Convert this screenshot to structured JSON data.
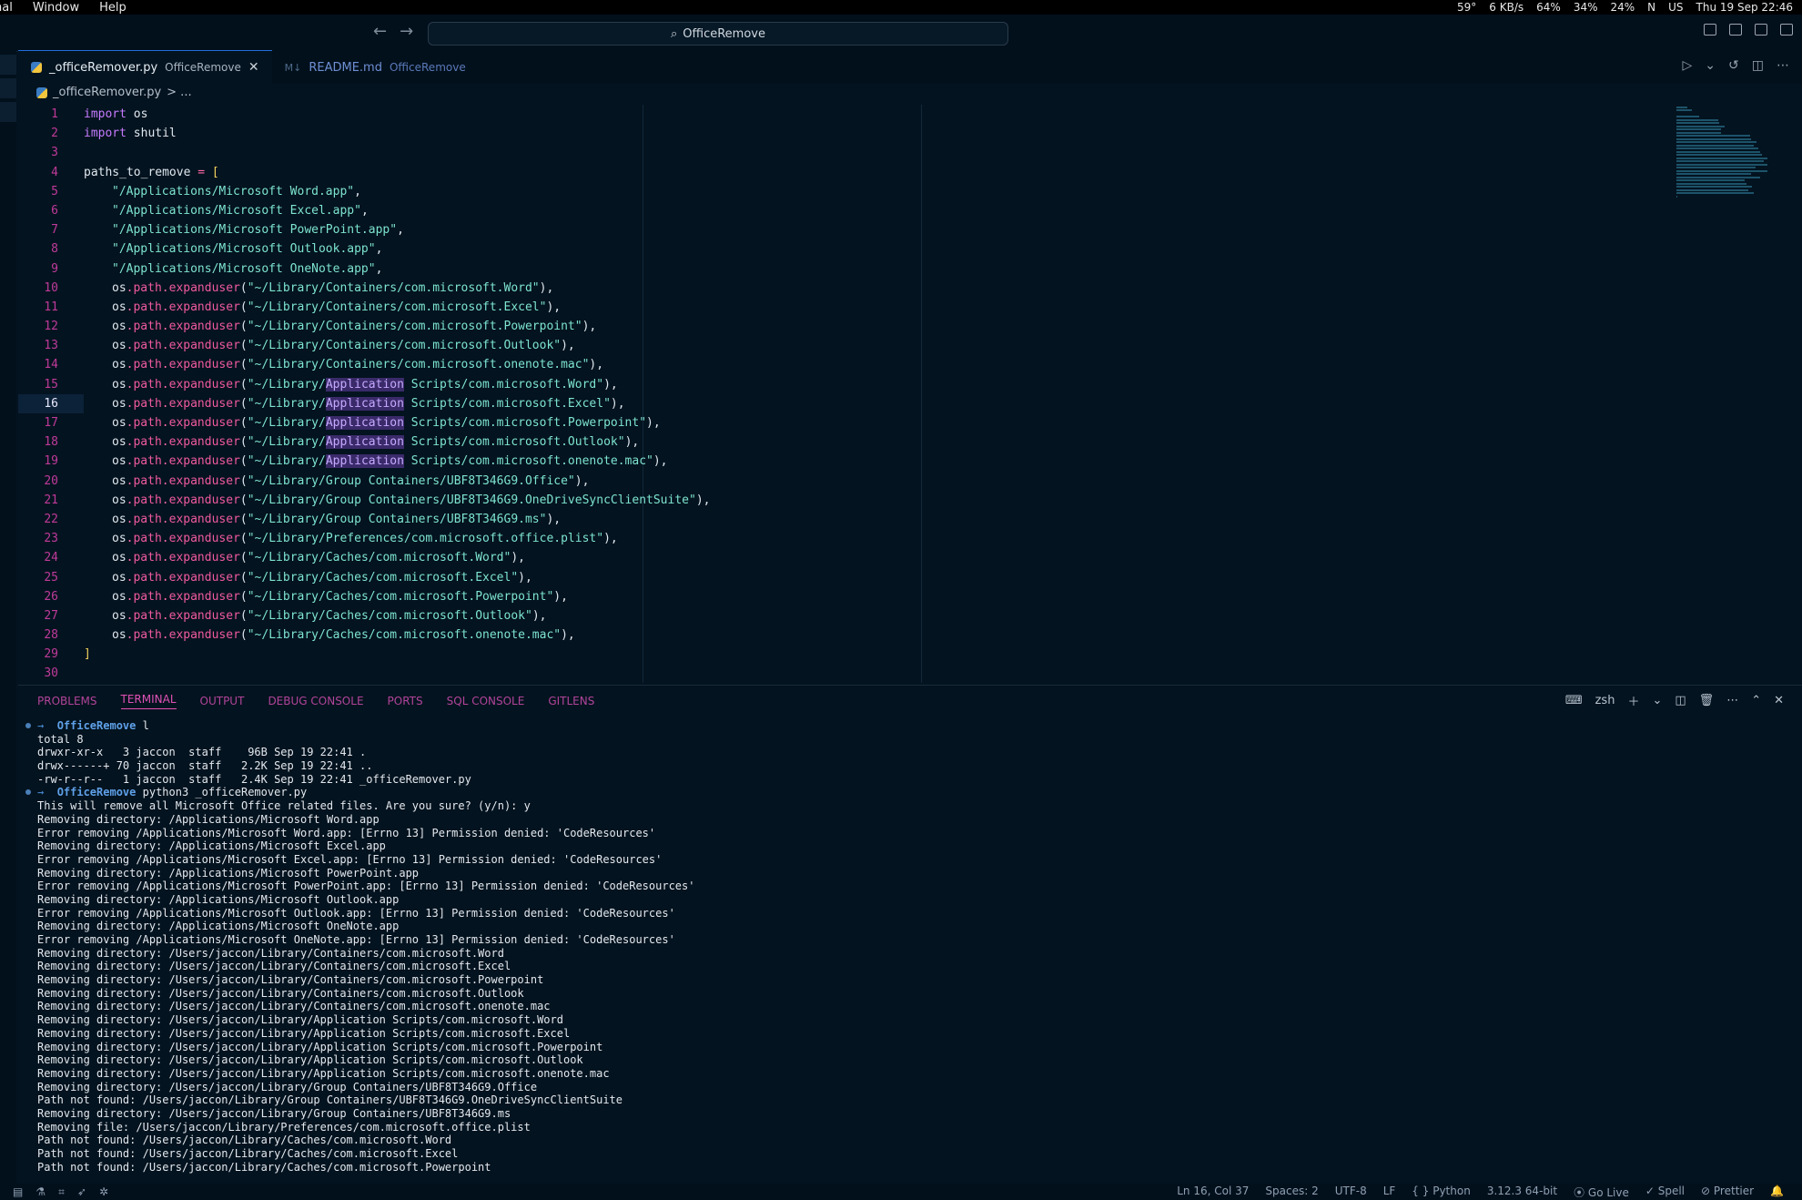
{
  "menubar": {
    "menus": [
      "nal",
      "Window",
      "Help"
    ],
    "status": [
      "59°",
      "6 KB/s",
      "64%",
      "34%",
      "24%",
      "N",
      "US",
      "Thu 19 Sep  22:46"
    ]
  },
  "titlebar": {
    "search_text": "OfficeRemove"
  },
  "tabs": [
    {
      "label": "_officeRemover.py",
      "sub": "OfficeRemove",
      "active": true
    },
    {
      "label": "README.md",
      "sub": "OfficeRemove",
      "active": false
    }
  ],
  "breadcrumb": {
    "file": "_officeRemover.py",
    "rest": "> ..."
  },
  "code": {
    "current_line": 16,
    "lines": [
      [
        [
          "kw",
          "import "
        ],
        [
          "id",
          "os"
        ]
      ],
      [
        [
          "kw",
          "import "
        ],
        [
          "id",
          "shutil"
        ]
      ],
      [],
      [
        [
          "id",
          "paths_to_remove "
        ],
        [
          "op",
          "= "
        ],
        [
          "brk",
          "["
        ]
      ],
      [
        [
          "ind",
          ""
        ],
        [
          "str",
          "\"/Applications/Microsoft Word.app\""
        ],
        [
          "id",
          ","
        ]
      ],
      [
        [
          "ind",
          ""
        ],
        [
          "str",
          "\"/Applications/Microsoft Excel.app\""
        ],
        [
          "id",
          ","
        ]
      ],
      [
        [
          "ind",
          ""
        ],
        [
          "str",
          "\"/Applications/Microsoft PowerPoint.app\""
        ],
        [
          "id",
          ","
        ]
      ],
      [
        [
          "ind",
          ""
        ],
        [
          "str",
          "\"/Applications/Microsoft Outlook.app\""
        ],
        [
          "id",
          ","
        ]
      ],
      [
        [
          "ind",
          ""
        ],
        [
          "str",
          "\"/Applications/Microsoft OneNote.app\""
        ],
        [
          "id",
          ","
        ]
      ],
      [
        [
          "ind",
          ""
        ],
        [
          "id",
          "os"
        ],
        [
          "op",
          "."
        ],
        [
          "fn",
          "path"
        ],
        [
          "op",
          "."
        ],
        [
          "fn",
          "expanduser"
        ],
        [
          "id",
          "("
        ],
        [
          "str",
          "\"~/Library/Containers/com.microsoft.Word\""
        ],
        [
          "id",
          "),"
        ]
      ],
      [
        [
          "ind",
          ""
        ],
        [
          "id",
          "os"
        ],
        [
          "op",
          "."
        ],
        [
          "fn",
          "path"
        ],
        [
          "op",
          "."
        ],
        [
          "fn",
          "expanduser"
        ],
        [
          "id",
          "("
        ],
        [
          "str",
          "\"~/Library/Containers/com.microsoft.Excel\""
        ],
        [
          "id",
          "),"
        ]
      ],
      [
        [
          "ind",
          ""
        ],
        [
          "id",
          "os"
        ],
        [
          "op",
          "."
        ],
        [
          "fn",
          "path"
        ],
        [
          "op",
          "."
        ],
        [
          "fn",
          "expanduser"
        ],
        [
          "id",
          "("
        ],
        [
          "str",
          "\"~/Library/Containers/com.microsoft.Powerpoint\""
        ],
        [
          "id",
          "),"
        ]
      ],
      [
        [
          "ind",
          ""
        ],
        [
          "id",
          "os"
        ],
        [
          "op",
          "."
        ],
        [
          "fn",
          "path"
        ],
        [
          "op",
          "."
        ],
        [
          "fn",
          "expanduser"
        ],
        [
          "id",
          "("
        ],
        [
          "str",
          "\"~/Library/Containers/com.microsoft.Outlook\""
        ],
        [
          "id",
          "),"
        ]
      ],
      [
        [
          "ind",
          ""
        ],
        [
          "id",
          "os"
        ],
        [
          "op",
          "."
        ],
        [
          "fn",
          "path"
        ],
        [
          "op",
          "."
        ],
        [
          "fn",
          "expanduser"
        ],
        [
          "id",
          "("
        ],
        [
          "str",
          "\"~/Library/Containers/com.microsoft.onenote.mac\""
        ],
        [
          "id",
          "),"
        ]
      ],
      [
        [
          "ind",
          ""
        ],
        [
          "id",
          "os"
        ],
        [
          "op",
          "."
        ],
        [
          "fn",
          "path"
        ],
        [
          "op",
          "."
        ],
        [
          "fn",
          "expanduser"
        ],
        [
          "id",
          "("
        ],
        [
          "str",
          "\"~/Library/"
        ],
        [
          "hl",
          "Application"
        ],
        [
          "str",
          " Scripts/com.microsoft.Word\""
        ],
        [
          "id",
          "),"
        ]
      ],
      [
        [
          "ind",
          ""
        ],
        [
          "id",
          "os"
        ],
        [
          "op",
          "."
        ],
        [
          "fn",
          "path"
        ],
        [
          "op",
          "."
        ],
        [
          "fn",
          "expanduser"
        ],
        [
          "id",
          "("
        ],
        [
          "str",
          "\"~/Library/"
        ],
        [
          "hl",
          "Application"
        ],
        [
          "str",
          " Scripts/com.microsoft.Excel\""
        ],
        [
          "id",
          "),"
        ]
      ],
      [
        [
          "ind",
          ""
        ],
        [
          "id",
          "os"
        ],
        [
          "op",
          "."
        ],
        [
          "fn",
          "path"
        ],
        [
          "op",
          "."
        ],
        [
          "fn",
          "expanduser"
        ],
        [
          "id",
          "("
        ],
        [
          "str",
          "\"~/Library/"
        ],
        [
          "hl",
          "Application"
        ],
        [
          "str",
          " Scripts/com.microsoft.Powerpoint\""
        ],
        [
          "id",
          "),"
        ]
      ],
      [
        [
          "ind",
          ""
        ],
        [
          "id",
          "os"
        ],
        [
          "op",
          "."
        ],
        [
          "fn",
          "path"
        ],
        [
          "op",
          "."
        ],
        [
          "fn",
          "expanduser"
        ],
        [
          "id",
          "("
        ],
        [
          "str",
          "\"~/Library/"
        ],
        [
          "hl",
          "Application"
        ],
        [
          "str",
          " Scripts/com.microsoft.Outlook\""
        ],
        [
          "id",
          "),"
        ]
      ],
      [
        [
          "ind",
          ""
        ],
        [
          "id",
          "os"
        ],
        [
          "op",
          "."
        ],
        [
          "fn",
          "path"
        ],
        [
          "op",
          "."
        ],
        [
          "fn",
          "expanduser"
        ],
        [
          "id",
          "("
        ],
        [
          "str",
          "\"~/Library/"
        ],
        [
          "hl",
          "Application"
        ],
        [
          "str",
          " Scripts/com.microsoft.onenote.mac\""
        ],
        [
          "id",
          "),"
        ]
      ],
      [
        [
          "ind",
          ""
        ],
        [
          "id",
          "os"
        ],
        [
          "op",
          "."
        ],
        [
          "fn",
          "path"
        ],
        [
          "op",
          "."
        ],
        [
          "fn",
          "expanduser"
        ],
        [
          "id",
          "("
        ],
        [
          "str",
          "\"~/Library/Group Containers/UBF8T346G9.Office\""
        ],
        [
          "id",
          "),"
        ]
      ],
      [
        [
          "ind",
          ""
        ],
        [
          "id",
          "os"
        ],
        [
          "op",
          "."
        ],
        [
          "fn",
          "path"
        ],
        [
          "op",
          "."
        ],
        [
          "fn",
          "expanduser"
        ],
        [
          "id",
          "("
        ],
        [
          "str",
          "\"~/Library/Group Containers/UBF8T346G9.OneDriveSyncClientSuite\""
        ],
        [
          "id",
          "),"
        ]
      ],
      [
        [
          "ind",
          ""
        ],
        [
          "id",
          "os"
        ],
        [
          "op",
          "."
        ],
        [
          "fn",
          "path"
        ],
        [
          "op",
          "."
        ],
        [
          "fn",
          "expanduser"
        ],
        [
          "id",
          "("
        ],
        [
          "str",
          "\"~/Library/Group Containers/UBF8T346G9.ms\""
        ],
        [
          "id",
          "),"
        ]
      ],
      [
        [
          "ind",
          ""
        ],
        [
          "id",
          "os"
        ],
        [
          "op",
          "."
        ],
        [
          "fn",
          "path"
        ],
        [
          "op",
          "."
        ],
        [
          "fn",
          "expanduser"
        ],
        [
          "id",
          "("
        ],
        [
          "str",
          "\"~/Library/Preferences/com.microsoft.office.plist\""
        ],
        [
          "id",
          "),"
        ]
      ],
      [
        [
          "ind",
          ""
        ],
        [
          "id",
          "os"
        ],
        [
          "op",
          "."
        ],
        [
          "fn",
          "path"
        ],
        [
          "op",
          "."
        ],
        [
          "fn",
          "expanduser"
        ],
        [
          "id",
          "("
        ],
        [
          "str",
          "\"~/Library/Caches/com.microsoft.Word\""
        ],
        [
          "id",
          "),"
        ]
      ],
      [
        [
          "ind",
          ""
        ],
        [
          "id",
          "os"
        ],
        [
          "op",
          "."
        ],
        [
          "fn",
          "path"
        ],
        [
          "op",
          "."
        ],
        [
          "fn",
          "expanduser"
        ],
        [
          "id",
          "("
        ],
        [
          "str",
          "\"~/Library/Caches/com.microsoft.Excel\""
        ],
        [
          "id",
          "),"
        ]
      ],
      [
        [
          "ind",
          ""
        ],
        [
          "id",
          "os"
        ],
        [
          "op",
          "."
        ],
        [
          "fn",
          "path"
        ],
        [
          "op",
          "."
        ],
        [
          "fn",
          "expanduser"
        ],
        [
          "id",
          "("
        ],
        [
          "str",
          "\"~/Library/Caches/com.microsoft.Powerpoint\""
        ],
        [
          "id",
          "),"
        ]
      ],
      [
        [
          "ind",
          ""
        ],
        [
          "id",
          "os"
        ],
        [
          "op",
          "."
        ],
        [
          "fn",
          "path"
        ],
        [
          "op",
          "."
        ],
        [
          "fn",
          "expanduser"
        ],
        [
          "id",
          "("
        ],
        [
          "str",
          "\"~/Library/Caches/com.microsoft.Outlook\""
        ],
        [
          "id",
          "),"
        ]
      ],
      [
        [
          "ind",
          ""
        ],
        [
          "id",
          "os"
        ],
        [
          "op",
          "."
        ],
        [
          "fn",
          "path"
        ],
        [
          "op",
          "."
        ],
        [
          "fn",
          "expanduser"
        ],
        [
          "id",
          "("
        ],
        [
          "str",
          "\"~/Library/Caches/com.microsoft.onenote.mac\""
        ],
        [
          "id",
          "),"
        ]
      ],
      [
        [
          "brk",
          "]"
        ]
      ],
      []
    ]
  },
  "panel": {
    "tabs": [
      "PROBLEMS",
      "TERMINAL",
      "OUTPUT",
      "DEBUG CONSOLE",
      "PORTS",
      "SQL CONSOLE",
      "GITLENS"
    ],
    "active_tab": "TERMINAL",
    "shell": "zsh"
  },
  "terminal": {
    "lines": [
      {
        "type": "prompt",
        "dir": "OfficeRemove",
        "cmd": "l"
      },
      {
        "text": "total 8"
      },
      {
        "text": "drwxr-xr-x   3 jaccon  staff    96B Sep 19 22:41 ."
      },
      {
        "text": "drwx------+ 70 jaccon  staff   2.2K Sep 19 22:41 .."
      },
      {
        "text": "-rw-r--r--   1 jaccon  staff   2.4K Sep 19 22:41 _officeRemover.py"
      },
      {
        "type": "prompt",
        "dir": "OfficeRemove",
        "cmd": "python3 _officeRemover.py"
      },
      {
        "text": "This will remove all Microsoft Office related files. Are you sure? (y/n): y"
      },
      {
        "text": "Removing directory: /Applications/Microsoft Word.app"
      },
      {
        "text": "Error removing /Applications/Microsoft Word.app: [Errno 13] Permission denied: 'CodeResources'"
      },
      {
        "text": "Removing directory: /Applications/Microsoft Excel.app"
      },
      {
        "text": "Error removing /Applications/Microsoft Excel.app: [Errno 13] Permission denied: 'CodeResources'"
      },
      {
        "text": "Removing directory: /Applications/Microsoft PowerPoint.app"
      },
      {
        "text": "Error removing /Applications/Microsoft PowerPoint.app: [Errno 13] Permission denied: 'CodeResources'"
      },
      {
        "text": "Removing directory: /Applications/Microsoft Outlook.app"
      },
      {
        "text": "Error removing /Applications/Microsoft Outlook.app: [Errno 13] Permission denied: 'CodeResources'"
      },
      {
        "text": "Removing directory: /Applications/Microsoft OneNote.app"
      },
      {
        "text": "Error removing /Applications/Microsoft OneNote.app: [Errno 13] Permission denied: 'CodeResources'"
      },
      {
        "text": "Removing directory: /Users/jaccon/Library/Containers/com.microsoft.Word"
      },
      {
        "text": "Removing directory: /Users/jaccon/Library/Containers/com.microsoft.Excel"
      },
      {
        "text": "Removing directory: /Users/jaccon/Library/Containers/com.microsoft.Powerpoint"
      },
      {
        "text": "Removing directory: /Users/jaccon/Library/Containers/com.microsoft.Outlook"
      },
      {
        "text": "Removing directory: /Users/jaccon/Library/Containers/com.microsoft.onenote.mac"
      },
      {
        "text": "Removing directory: /Users/jaccon/Library/Application Scripts/com.microsoft.Word"
      },
      {
        "text": "Removing directory: /Users/jaccon/Library/Application Scripts/com.microsoft.Excel"
      },
      {
        "text": "Removing directory: /Users/jaccon/Library/Application Scripts/com.microsoft.Powerpoint"
      },
      {
        "text": "Removing directory: /Users/jaccon/Library/Application Scripts/com.microsoft.Outlook"
      },
      {
        "text": "Removing directory: /Users/jaccon/Library/Application Scripts/com.microsoft.onenote.mac"
      },
      {
        "text": "Removing directory: /Users/jaccon/Library/Group Containers/UBF8T346G9.Office"
      },
      {
        "text": "Path not found: /Users/jaccon/Library/Group Containers/UBF8T346G9.OneDriveSyncClientSuite"
      },
      {
        "text": "Removing directory: /Users/jaccon/Library/Group Containers/UBF8T346G9.ms"
      },
      {
        "text": "Removing file: /Users/jaccon/Library/Preferences/com.microsoft.office.plist"
      },
      {
        "text": "Path not found: /Users/jaccon/Library/Caches/com.microsoft.Word"
      },
      {
        "text": "Path not found: /Users/jaccon/Library/Caches/com.microsoft.Excel"
      },
      {
        "text": "Path not found: /Users/jaccon/Library/Caches/com.microsoft.Powerpoint"
      }
    ]
  },
  "statusbar": {
    "position": "Ln 16, Col 37",
    "spaces": "Spaces: 2",
    "encoding": "UTF-8",
    "eol": "LF",
    "language": "Python",
    "interpreter": "3.12.3 64-bit",
    "golive": "Go Live",
    "spell": "Spell",
    "prettier": "Prettier"
  }
}
